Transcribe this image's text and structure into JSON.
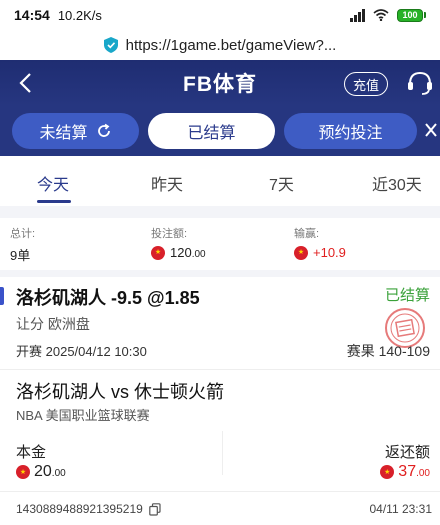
{
  "status": {
    "time": "14:54",
    "speed": "10.2K/s",
    "battery": "100"
  },
  "url": {
    "text": "https://1game.bet/gameView?..."
  },
  "header": {
    "title": "FB体育",
    "recharge": "充值"
  },
  "subtabs": [
    {
      "label": "未结算",
      "active": false
    },
    {
      "label": "已结算",
      "active": true
    },
    {
      "label": "预约投注",
      "active": false
    }
  ],
  "time_tabs": [
    {
      "label": "今天",
      "active": true
    },
    {
      "label": "昨天",
      "active": false
    },
    {
      "label": "7天",
      "active": false
    },
    {
      "label": "近30天",
      "active": false
    }
  ],
  "summary": {
    "total_label": "总计:",
    "total_value": "9单",
    "stake_label": "投注额:",
    "stake_int": "120",
    "stake_dec": ".00",
    "result_label": "输赢:",
    "result_value": "+10.9"
  },
  "bet": {
    "title": "洛杉矶湖人 -9.5 @1.85",
    "status": "已结算",
    "market": "让分 欧洲盘",
    "start_label": "开赛",
    "start_time": "2025/04/12 10:30",
    "score_label": "赛果",
    "score": "140-109",
    "match": "洛杉矶湖人 vs 休士顿火箭",
    "league": "NBA 美国职业篮球联赛",
    "stake_label": "本金",
    "stake_int": "20",
    "stake_dec": ".00",
    "return_label": "返还额",
    "return_int": "37",
    "return_dec": ".00",
    "order_no": "1430889488921395219",
    "order_time": "04/11 23:31"
  },
  "colors": {
    "header": "#1f2d72",
    "accent": "#3a52c9",
    "win": "#e02020",
    "settled": "#3aa13a"
  }
}
